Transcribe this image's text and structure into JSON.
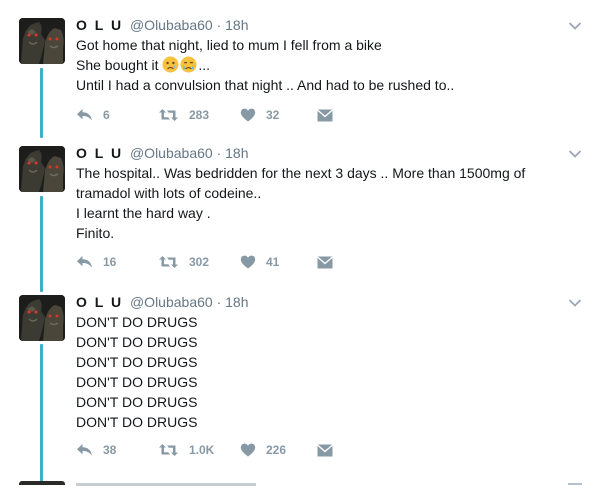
{
  "tweets": [
    {
      "name": "O L U",
      "handle": "@Olubaba60",
      "separator": "·",
      "time": "18h",
      "lines": [
        "Got home that night, lied to mum I fell from a bike",
        "She bought it",
        "...",
        "Until I had a convulsion that night .. And had to be rushed to.."
      ],
      "replies": "6",
      "retweets": "283",
      "likes": "32"
    },
    {
      "name": "O L U",
      "handle": "@Olubaba60",
      "separator": "·",
      "time": "18h",
      "lines": [
        "The hospital.. Was bedridden for the next 3 days .. More than 1500mg of",
        "tramadol with lots of codeine..",
        "I learnt the hard way .",
        "Finito."
      ],
      "replies": "16",
      "retweets": "302",
      "likes": "41"
    },
    {
      "name": "O L U",
      "handle": "@Olubaba60",
      "separator": "·",
      "time": "18h",
      "lines": [
        "DON'T DO DRUGS",
        "DON'T DO DRUGS",
        "DON'T DO DRUGS",
        "DON'T DO DRUGS",
        "DON'T DO DRUGS",
        "DON'T DO DRUGS"
      ],
      "replies": "38",
      "retweets": "1.0K",
      "likes": "226"
    }
  ],
  "icons": {
    "reply": "reply-icon",
    "retweet": "retweet-icon",
    "like": "heart-icon",
    "message": "envelope-icon",
    "caret": "chevron-down-icon",
    "emoji": "sad-face-emoji"
  },
  "colors": {
    "thread_line": "#3bb0c9",
    "action_icon": "#8899a6",
    "meta_text": "#657786",
    "body_text": "#14171a"
  }
}
